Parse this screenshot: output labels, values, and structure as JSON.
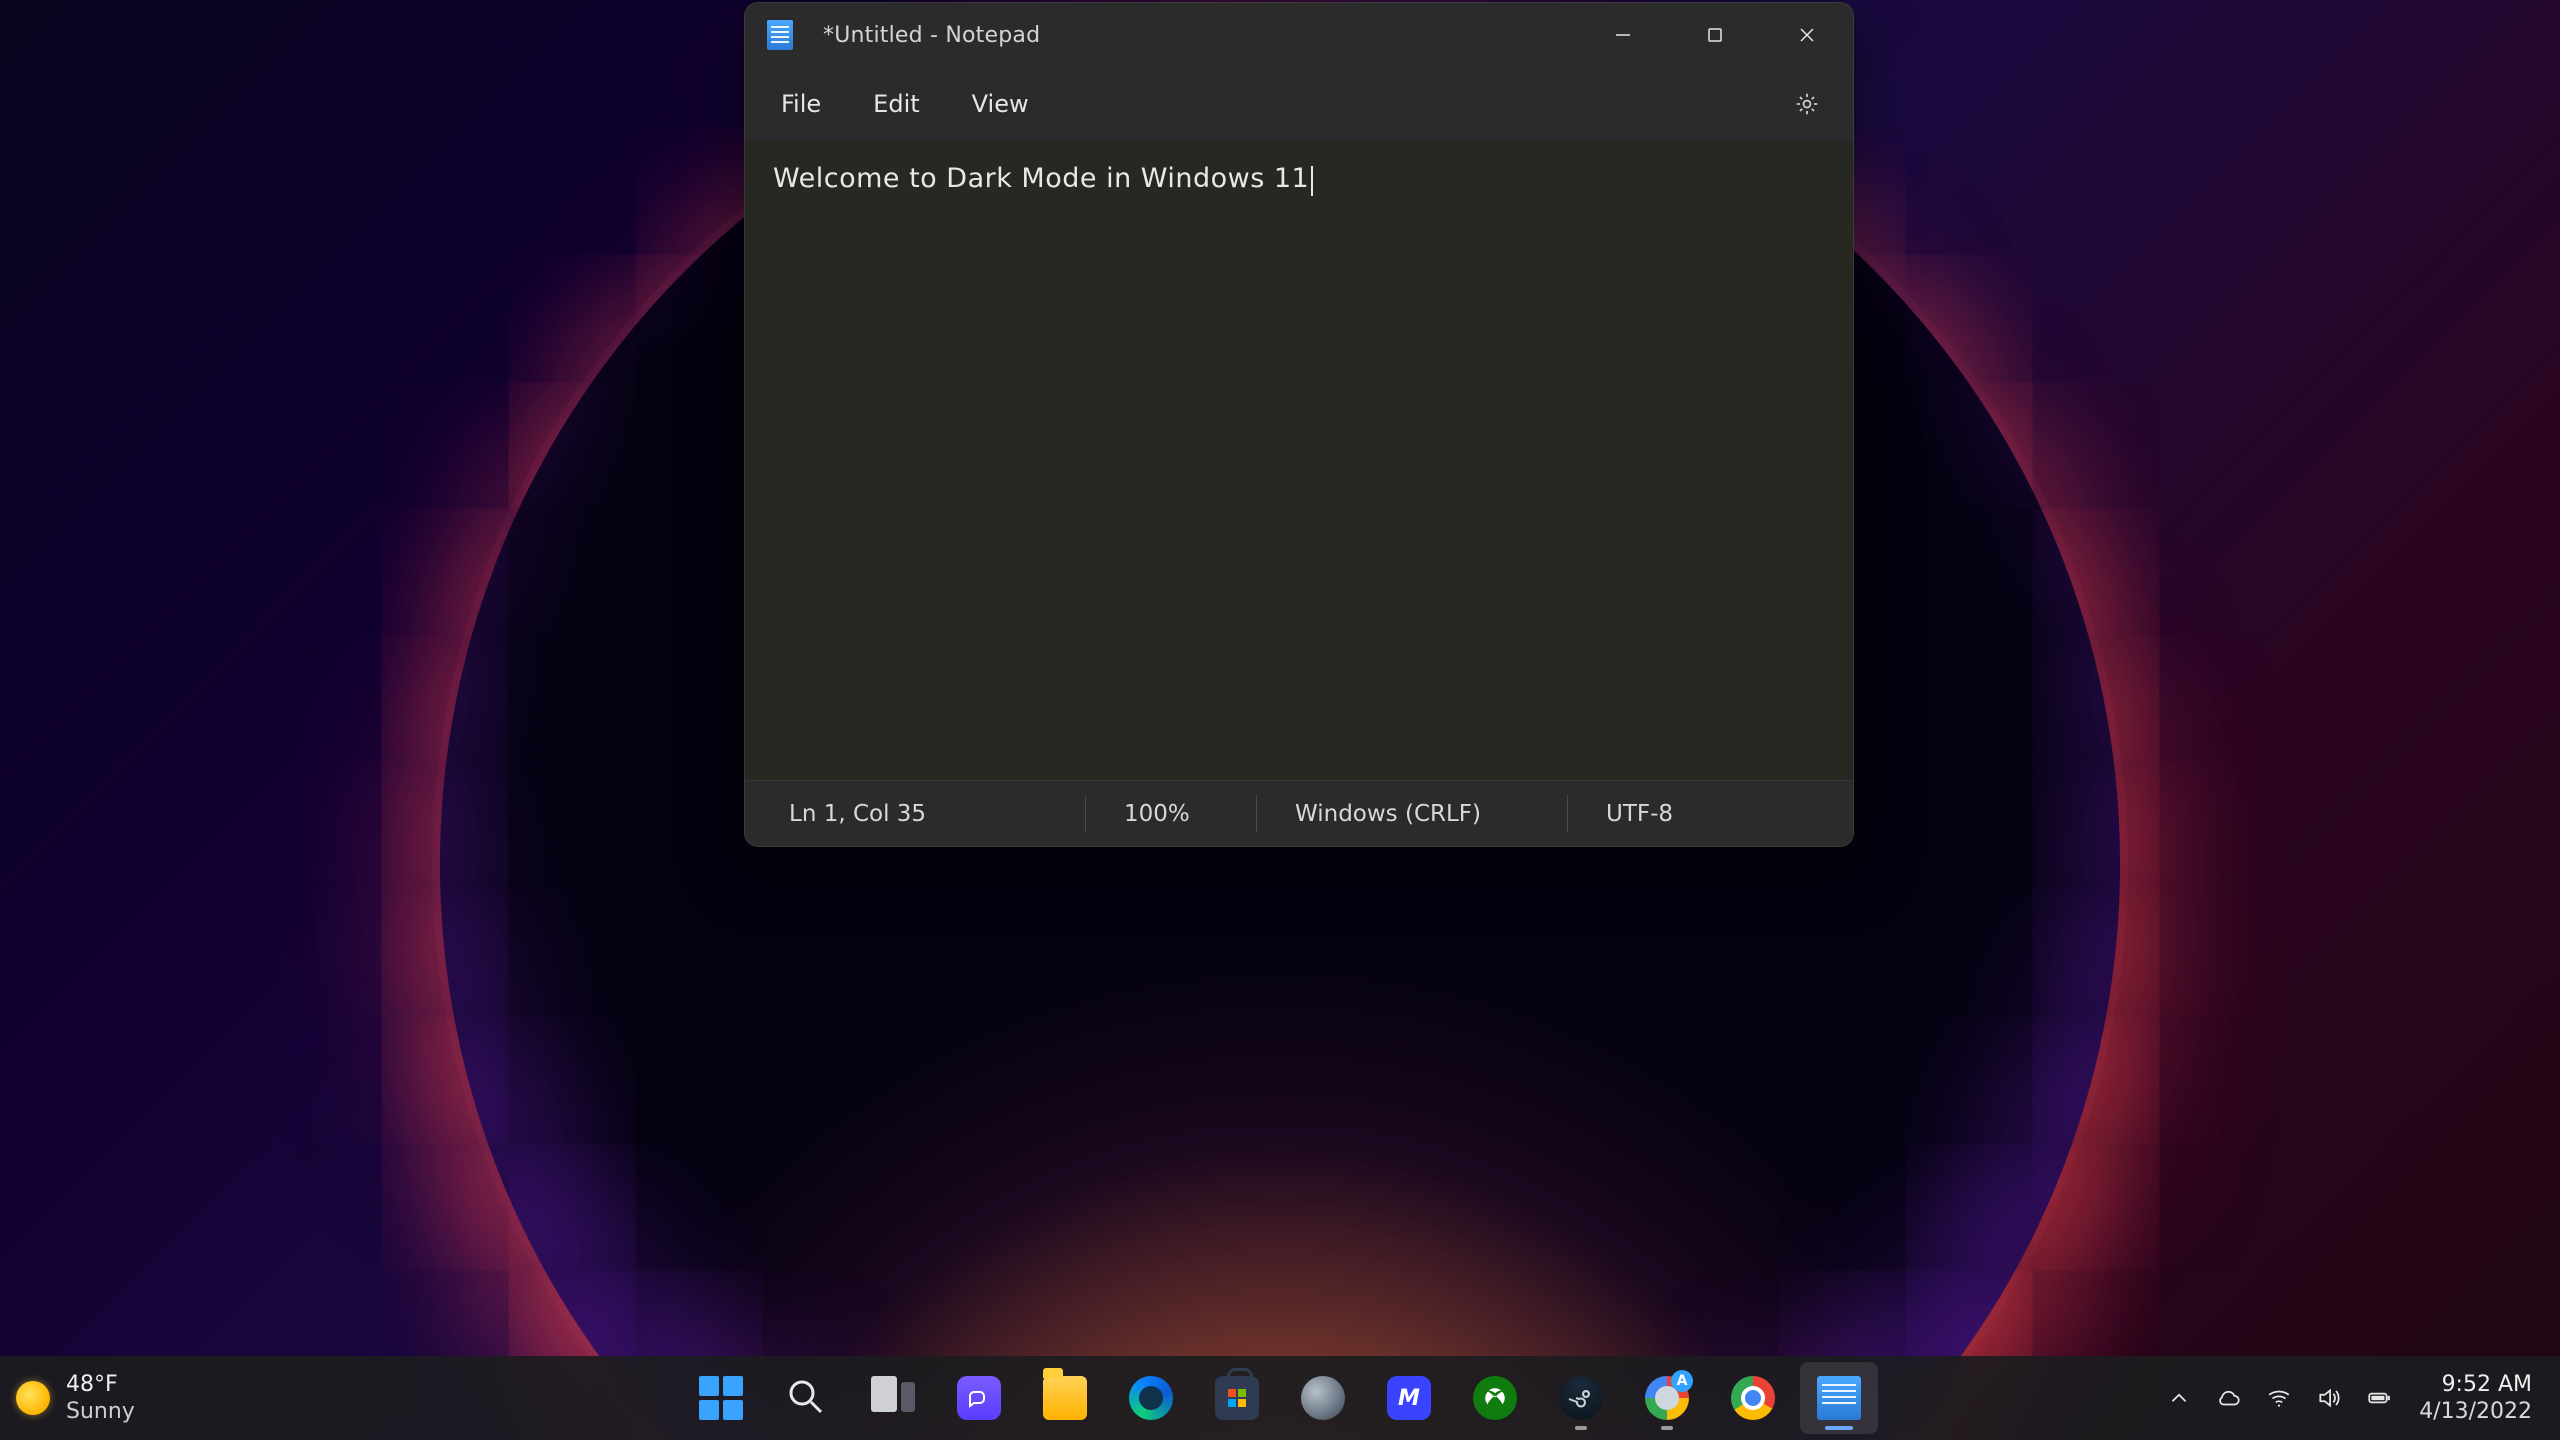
{
  "window": {
    "title": "*Untitled - Notepad",
    "menus": {
      "file": "File",
      "edit": "Edit",
      "view": "View"
    },
    "content": "Welcome to Dark Mode in Windows 11",
    "status": {
      "position": "Ln 1, Col 35",
      "zoom": "100%",
      "eol": "Windows (CRLF)",
      "encoding": "UTF-8"
    }
  },
  "taskbar": {
    "weather": {
      "temp": "48°F",
      "condition": "Sunny"
    },
    "canary_badge": "A",
    "app_letter": "M",
    "clock": {
      "time": "9:52 AM",
      "date": "4/13/2022"
    }
  }
}
